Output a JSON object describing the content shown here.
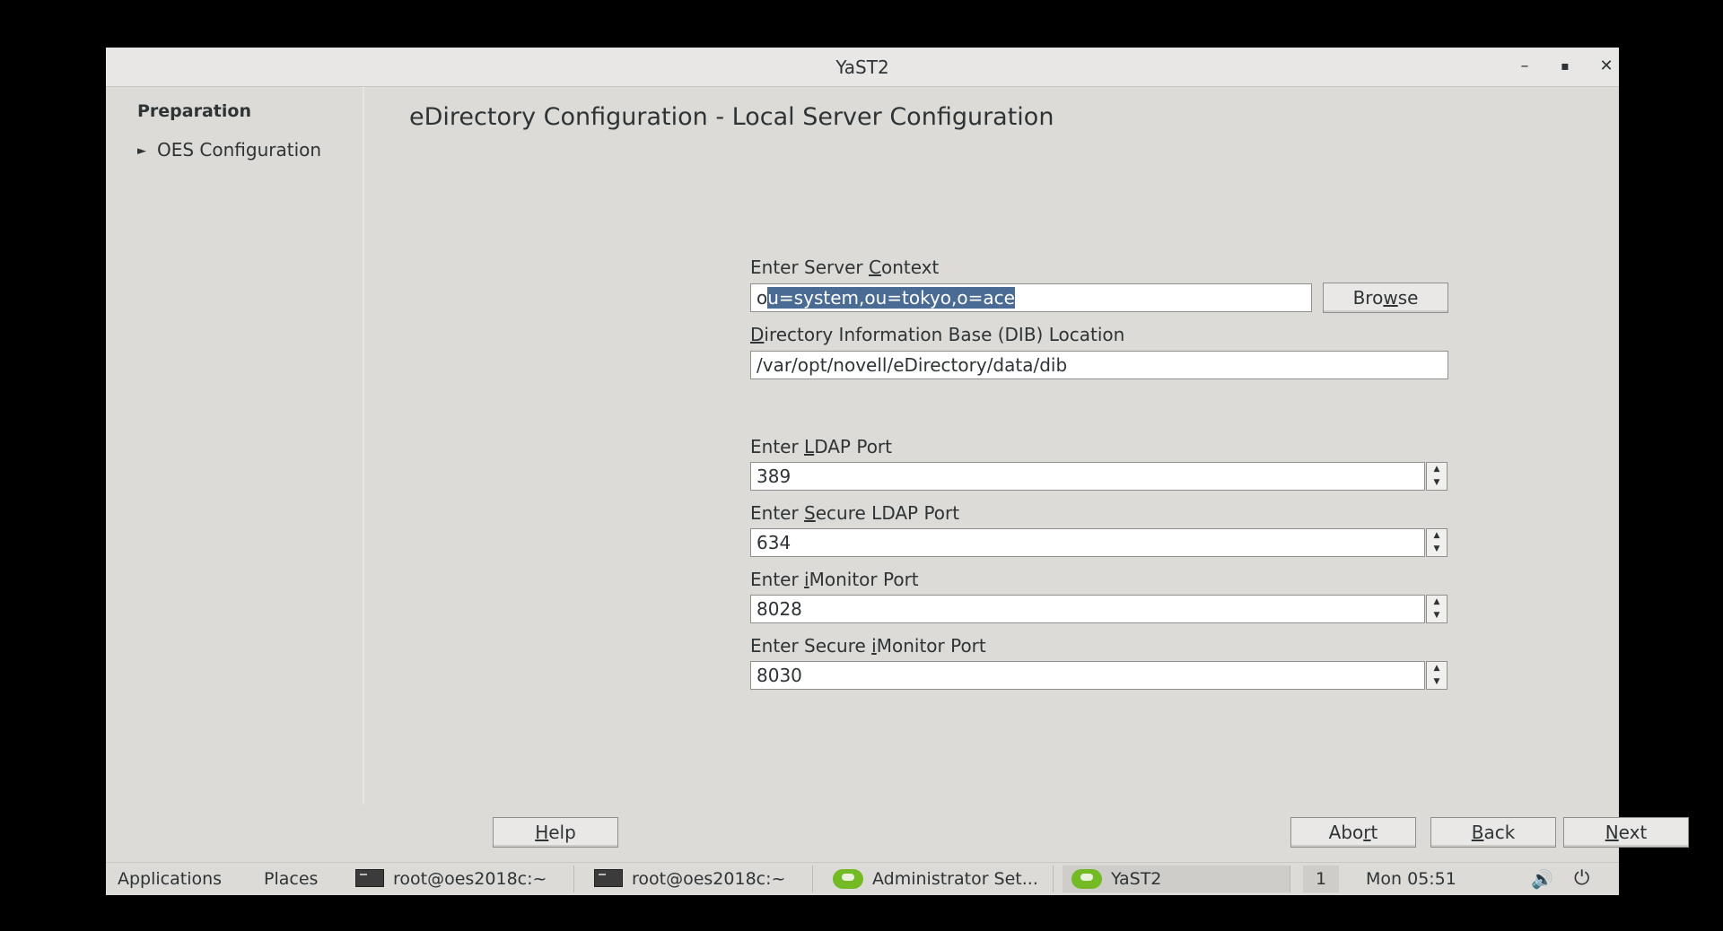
{
  "window": {
    "title": "YaST2",
    "controls": {
      "minimize": "–",
      "maximize": "▪",
      "close": "✕"
    }
  },
  "sidebar": {
    "heading": "Preparation",
    "items": [
      {
        "label": "OES Configuration",
        "arrow": "►"
      }
    ]
  },
  "page": {
    "title": "eDirectory Configuration - Local Server Configuration"
  },
  "form": {
    "server_context": {
      "label_pre": "Enter Server ",
      "label_key": "C",
      "label_post": "ontext",
      "value_unselected": "o",
      "value_selected": "u=system,ou=tokyo,o=ace",
      "browse_pre": "Bro",
      "browse_key": "w",
      "browse_post": "se"
    },
    "dib_location": {
      "label_pre": "",
      "label_key": "D",
      "label_post": "irectory Information Base (DIB) Location",
      "value": "/var/opt/novell/eDirectory/data/dib"
    },
    "ldap_port": {
      "label_pre": "Enter ",
      "label_key": "L",
      "label_post": "DAP Port",
      "value": "389"
    },
    "secure_ldap_port": {
      "label_pre": "Enter ",
      "label_key": "S",
      "label_post": "ecure LDAP Port",
      "value": "634"
    },
    "imonitor_port": {
      "label_pre": "Enter ",
      "label_key": "i",
      "label_post": "Monitor Port",
      "value": "8028"
    },
    "secure_imonitor_port": {
      "label_pre": "Enter Secure ",
      "label_key": "i",
      "label_post": "Monitor Port",
      "value": "8030"
    }
  },
  "buttons": {
    "help": {
      "key": "H",
      "rest": "elp"
    },
    "abort": {
      "pre": "Abo",
      "key": "r",
      "rest": "t"
    },
    "back": {
      "key": "B",
      "rest": "ack"
    },
    "next": {
      "key": "N",
      "rest": "ext"
    }
  },
  "taskbar": {
    "applications": "Applications",
    "places": "Places",
    "tasks": [
      {
        "label": "root@oes2018c:~",
        "icon": "terminal-icon"
      },
      {
        "label": "root@oes2018c:~",
        "icon": "terminal-icon"
      },
      {
        "label": "Administrator Set...",
        "icon": "yast-gecko-icon"
      },
      {
        "label": "YaST2",
        "icon": "yast-gecko-icon"
      }
    ],
    "workspace": "1",
    "clock": "Mon 05:51"
  },
  "colors": {
    "selection": "#4a6b94",
    "background": "#dddbd7",
    "accent_icon": "#73ba25"
  }
}
